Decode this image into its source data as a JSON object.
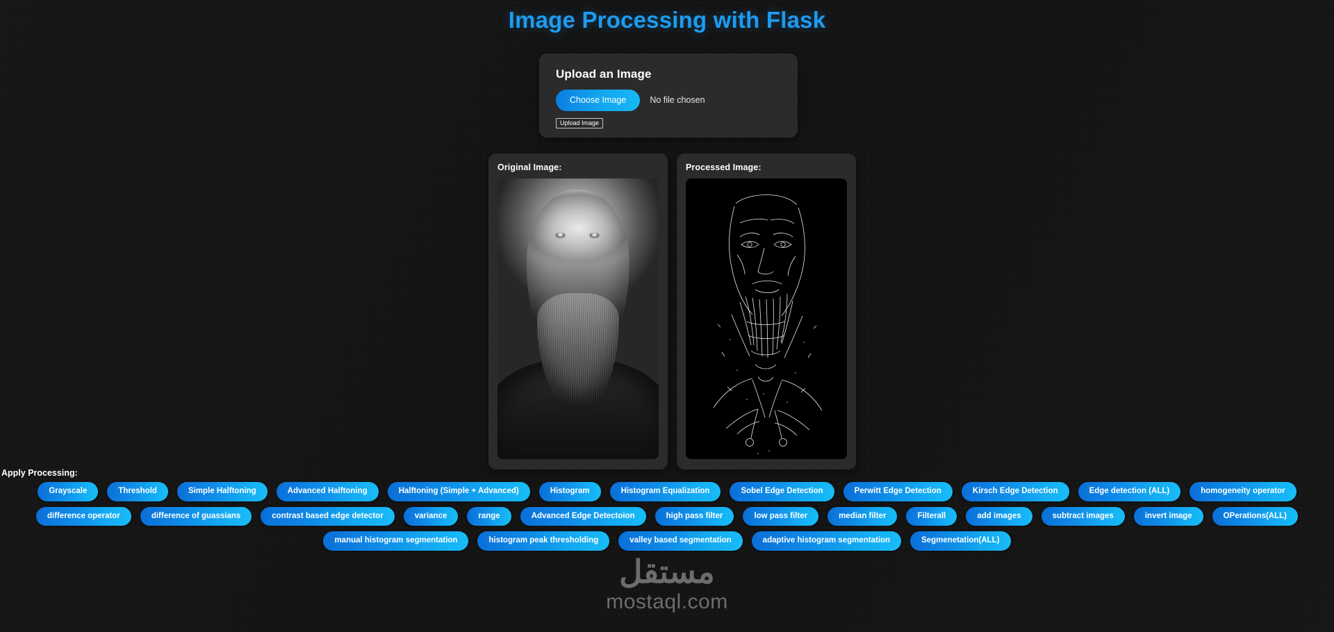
{
  "page": {
    "title": "Image Processing with Flask",
    "accent_color": "#1e9bf0",
    "background_color": "#141414",
    "card_color": "#2b2b2b"
  },
  "upload": {
    "heading": "Upload an Image",
    "choose_button": "Choose Image",
    "file_status": "No file chosen",
    "submit_button": "Upload Image"
  },
  "panels": {
    "original_label": "Original Image:",
    "processed_label": "Processed Image:"
  },
  "processing": {
    "label": "Apply Processing:",
    "rows": [
      [
        "Grayscale",
        "Threshold",
        "Simple Halftoning",
        "Advanced Halftoning",
        "Halftoning (Simple + Advanced)",
        "Histogram",
        "Histogram Equalization",
        "Sobel Edge Detection",
        "Perwitt Edge Detection",
        "Kirsch Edge Detection",
        "Edge detection (ALL)",
        "homogeneity operator"
      ],
      [
        "difference operator",
        "difference of guassians",
        "contrast based edge detector",
        "variance",
        "range",
        "Advanced Edge Detectoion",
        "high pass filter",
        "low pass filter",
        "median filter",
        "Filterall",
        "add images",
        "subtract images",
        "invert image",
        "OPerations(ALL)"
      ],
      [
        "manual histogram segmentation",
        "histogram peak thresholding",
        "valley based segmentation",
        "adaptive histogram segmentation",
        "Segmenetation(ALL)"
      ]
    ]
  },
  "watermark": {
    "arabic": "مستقل",
    "latin": "mostaql.com"
  }
}
